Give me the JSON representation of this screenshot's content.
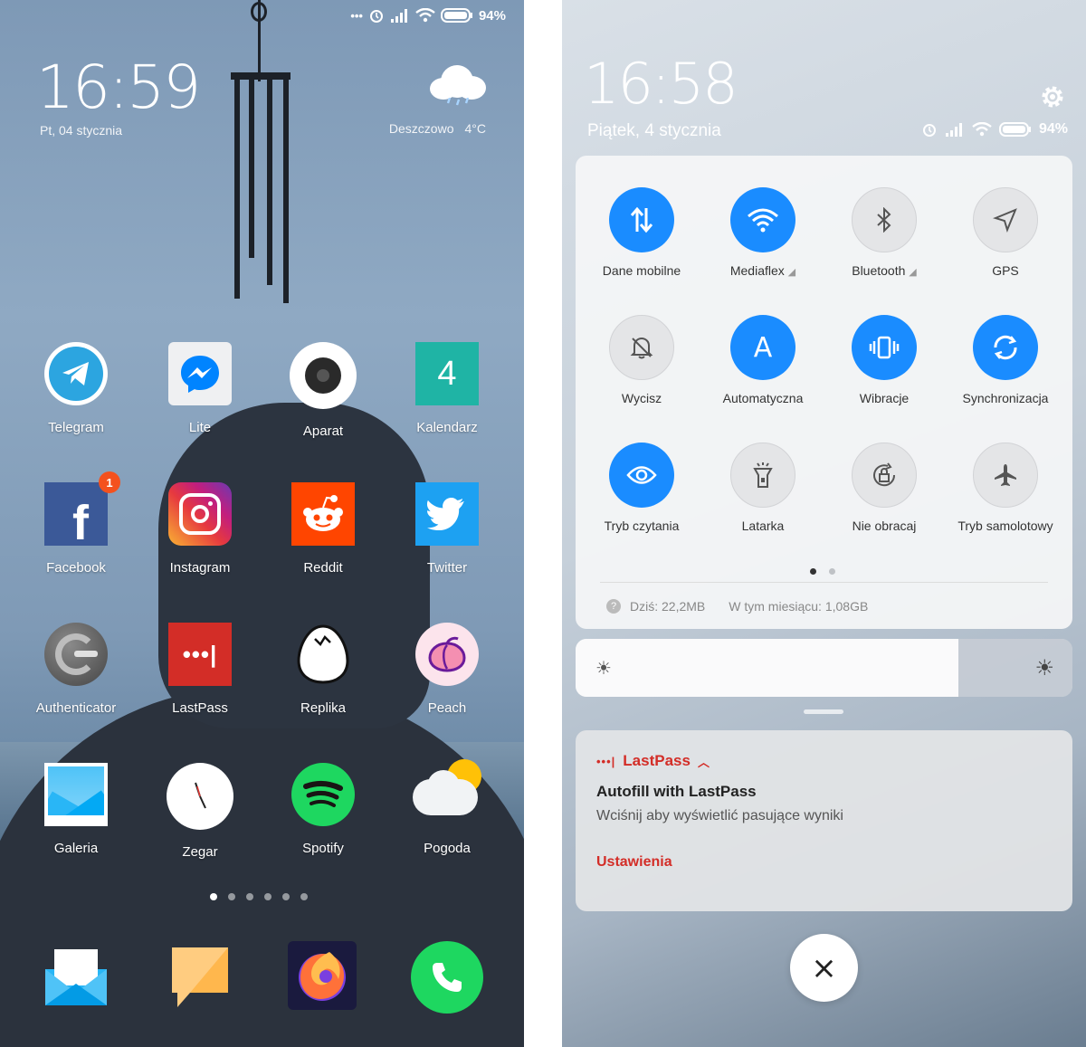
{
  "home": {
    "status": {
      "battery": "94%",
      "icons": [
        "more-icon",
        "alarm-icon",
        "signal-icon",
        "wifi-icon",
        "battery-icon"
      ]
    },
    "clock": "16:59",
    "date": "Pt, 04 stycznia",
    "weather": {
      "condition": "Deszczowo",
      "temp": "4°C"
    },
    "apps": [
      {
        "label": "Telegram"
      },
      {
        "label": "Lite"
      },
      {
        "label": "Aparat"
      },
      {
        "label": "Kalendarz",
        "glyph": "4"
      },
      {
        "label": "Facebook",
        "badge": "1",
        "glyph": "f"
      },
      {
        "label": "Instagram"
      },
      {
        "label": "Reddit"
      },
      {
        "label": "Twitter"
      },
      {
        "label": "Authenticator"
      },
      {
        "label": "LastPass",
        "glyph": "•••|"
      },
      {
        "label": "Replika"
      },
      {
        "label": "Peach"
      },
      {
        "label": "Galeria"
      },
      {
        "label": "Zegar"
      },
      {
        "label": "Spotify"
      },
      {
        "label": "Pogoda"
      }
    ],
    "page_count": 6,
    "active_page": 1,
    "dock": [
      "mail-icon",
      "messages-icon",
      "firefox-icon",
      "phone-icon"
    ]
  },
  "shade": {
    "clock": "16:58",
    "date": "Piątek, 4 stycznia",
    "battery": "94%",
    "toggles": [
      {
        "label": "Dane mobilne",
        "on": true
      },
      {
        "label": "Mediaflex",
        "on": true
      },
      {
        "label": "Bluetooth",
        "on": false
      },
      {
        "label": "GPS",
        "on": false
      },
      {
        "label": "Wycisz",
        "on": false
      },
      {
        "label": "Automatyczna",
        "on": true,
        "glyph": "A"
      },
      {
        "label": "Wibracje",
        "on": true
      },
      {
        "label": "Synchronizacja",
        "on": true
      },
      {
        "label": "Tryb czytania",
        "on": true
      },
      {
        "label": "Latarka",
        "on": false
      },
      {
        "label": "Nie obracaj",
        "on": false
      },
      {
        "label": "Tryb samolotowy",
        "on": false
      }
    ],
    "usage_today": "Dziś: 22,2MB",
    "usage_month": "W tym miesiącu: 1,08GB",
    "brightness": 0.77,
    "notification": {
      "app": "LastPass",
      "app_glyph": "•••|",
      "title": "Autofill with LastPass",
      "text": "Wciśnij aby wyświetlić pasujące wyniki",
      "action": "Ustawienia",
      "close_glyph": "×"
    }
  },
  "colors": {
    "accent": "#1a8cff",
    "lastpass_red": "#d32d27"
  }
}
